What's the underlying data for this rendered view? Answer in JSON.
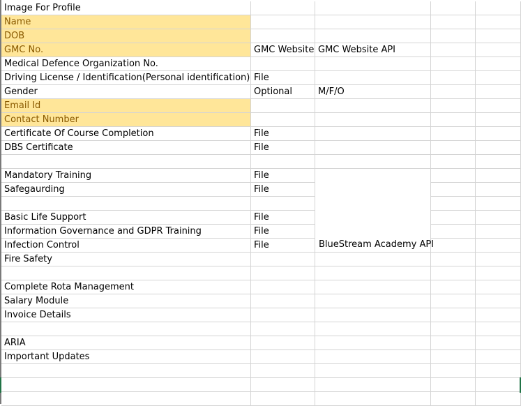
{
  "rows": [
    {
      "a": "Image For Profile",
      "b": "",
      "c": "",
      "hl": false
    },
    {
      "a": "Name",
      "b": "",
      "c": "",
      "hl": true
    },
    {
      "a": "DOB",
      "b": "",
      "c": "",
      "hl": true
    },
    {
      "a": "GMC No.",
      "b": "GMC Website",
      "c": "GMC Website API",
      "hl": true
    },
    {
      "a": "Medical Defence Organization No.",
      "b": "",
      "c": "",
      "hl": false
    },
    {
      "a": "Driving License / Identification(Personal identification)",
      "b": "File",
      "c": "",
      "hl": false
    },
    {
      "a": "Gender",
      "b": "Optional",
      "c": "M/F/O",
      "hl": false
    },
    {
      "a": "Email Id",
      "b": "",
      "c": "",
      "hl": true
    },
    {
      "a": "Contact Number",
      "b": "",
      "c": "",
      "hl": true
    },
    {
      "a": "Certificate Of Course Completion",
      "b": "File",
      "c": "",
      "hl": false
    },
    {
      "a": "DBS Certificate",
      "b": "File",
      "c": "",
      "hl": false
    },
    {
      "a": "",
      "b": "",
      "c": "",
      "hl": false
    },
    {
      "a": "Mandatory Training",
      "b": "File",
      "c": "",
      "hl": false
    },
    {
      "a": "Safegaurding",
      "b": "File",
      "c": "",
      "hl": false
    },
    {
      "a": "",
      "b": "",
      "c": "",
      "hl": false
    },
    {
      "a": "Basic Life Support",
      "b": "File",
      "c": "",
      "hl": false
    },
    {
      "a": "Information Governance and GDPR Training",
      "b": "File",
      "c": "",
      "hl": false
    },
    {
      "a": "Infection Control",
      "b": "File",
      "c": "",
      "hl": false
    },
    {
      "a": "Fire Safety",
      "b": "",
      "c": "",
      "hl": false
    },
    {
      "a": "",
      "b": "",
      "c": "",
      "hl": false
    },
    {
      "a": "Complete Rota Management",
      "b": "",
      "c": "",
      "hl": false
    },
    {
      "a": "Salary Module",
      "b": "",
      "c": "",
      "hl": false
    },
    {
      "a": "Invoice Details",
      "b": "",
      "c": "",
      "hl": false
    },
    {
      "a": "",
      "b": "",
      "c": "",
      "hl": false
    },
    {
      "a": "ARIA",
      "b": "",
      "c": "",
      "hl": false
    },
    {
      "a": "Important Updates",
      "b": "",
      "c": "",
      "hl": false
    },
    {
      "a": "",
      "b": "",
      "c": "",
      "hl": false
    },
    {
      "a": "",
      "b": "",
      "c": "",
      "hl": false
    },
    {
      "a": "",
      "b": "",
      "c": "",
      "hl": false
    }
  ],
  "merged_label": "BlueStream Academy API",
  "colors": {
    "highlight": "#ffe699",
    "highlight_text": "#8a5a00",
    "grid": "#d4d4d4",
    "selection": "#217346"
  }
}
